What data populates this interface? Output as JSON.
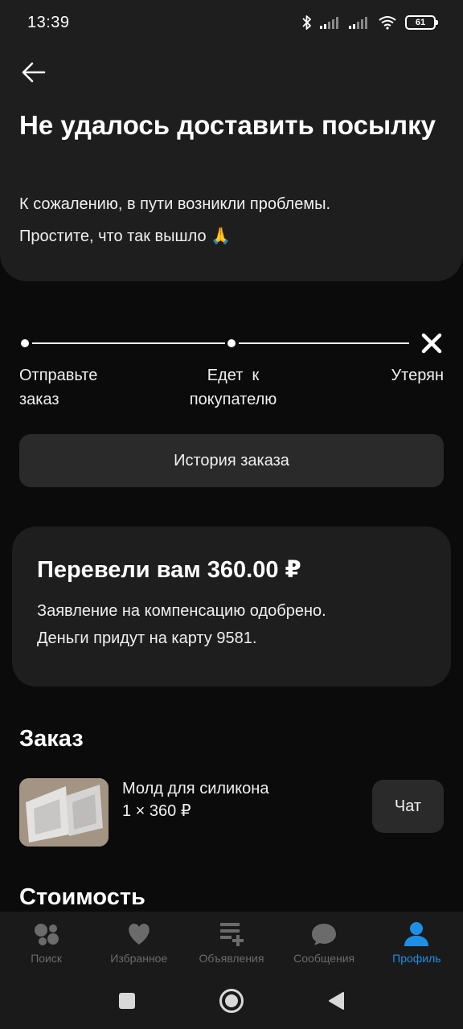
{
  "status_bar": {
    "time": "13:39",
    "battery": "61",
    "icons": [
      "bluetooth-icon",
      "signal-icon",
      "signal-icon",
      "wifi-icon",
      "battery-icon"
    ]
  },
  "header": {
    "back_icon": "arrow-left-icon",
    "title": "Не удалось доставить посылку",
    "subtitle_line1": "К сожалению, в пути возникли проблемы.",
    "subtitle_line2": "Простите, что так вышло 🙏"
  },
  "tracker": {
    "stages": [
      {
        "label_line1": "Отправьте",
        "label_line2": "заказ"
      },
      {
        "label_line1": "Едет  к",
        "label_line2": "покупателю"
      },
      {
        "label_line1": "Утерян",
        "label_line2": ""
      }
    ],
    "status_icon": "close-icon"
  },
  "history_button": "История заказа",
  "compensation": {
    "title": "Перевели вам 360.00 ₽",
    "line1": "Заявление на компенсацию одобрено.",
    "line2": "Деньги придут на карту 9581."
  },
  "order": {
    "section_title": "Заказ",
    "product_name": "Молд для силикона",
    "product_price": "1 × 360 ₽",
    "chat_button": "Чат"
  },
  "cost": {
    "section_title": "Стоимость"
  },
  "bottom_nav": {
    "items": [
      {
        "label": "Поиск",
        "icon": "search-dots-icon",
        "active": false
      },
      {
        "label": "Избранное",
        "icon": "heart-icon",
        "active": false
      },
      {
        "label": "Объявления",
        "icon": "listings-icon",
        "active": false
      },
      {
        "label": "Сообщения",
        "icon": "chat-bubble-icon",
        "active": false
      },
      {
        "label": "Профиль",
        "icon": "profile-icon",
        "active": true
      }
    ],
    "active_color": "#1e8fe6",
    "inactive_color": "#6b6b6b"
  },
  "system_nav": {
    "icons": [
      "square-icon",
      "home-circle-icon",
      "back-triangle-icon"
    ]
  }
}
